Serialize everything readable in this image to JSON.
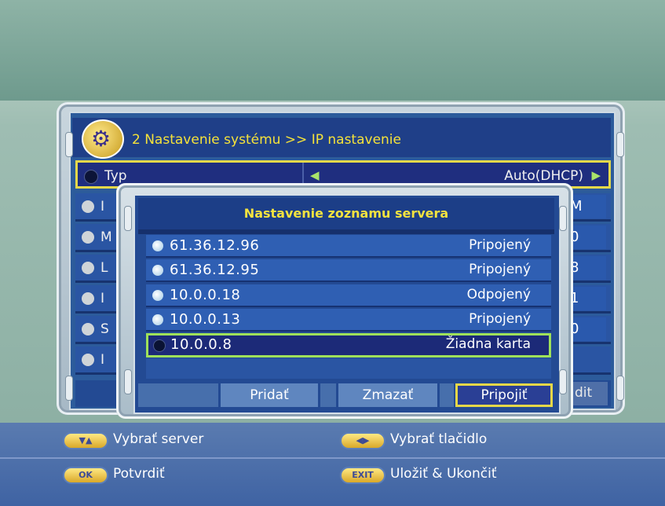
{
  "window": {
    "title": "2 Nastavenie systému >> IP nastavenie",
    "typ_label": "Typ",
    "typ_value": "Auto(DHCP)",
    "bg_row_initials": [
      "I",
      "M",
      "L",
      "I",
      "S",
      "I"
    ],
    "bg_row_values": [
      "M",
      "0",
      "8",
      "1",
      "0"
    ],
    "bg_button_label": "dit"
  },
  "dialog": {
    "title": "Nastavenie zoznamu servera",
    "servers": [
      {
        "ip": "61.36.12.96",
        "status": "Pripojený"
      },
      {
        "ip": "61.36.12.95",
        "status": "Pripojený"
      },
      {
        "ip": "10.0.0.18",
        "status": "Odpojený"
      },
      {
        "ip": "10.0.0.13",
        "status": "Pripojený"
      },
      {
        "ip": "10.0.0.8",
        "status": "Žiadna karta"
      }
    ],
    "buttons": {
      "add": "Pridať",
      "delete": "Zmazať",
      "connect": "Pripojiť"
    }
  },
  "help": {
    "select_server_key": "▼▲",
    "select_server": "Vybrať server",
    "select_button_key": "◀▶",
    "select_button": "Vybrať tlačidlo",
    "ok_key": "OK",
    "confirm": "Potvrdiť",
    "exit_key": "EXIT",
    "save_exit": "Uložiť & Ukončiť"
  },
  "colors": {
    "title_text": "#f4e33f",
    "highlight_border": "#e5d848",
    "selected_row_border": "#9fe15a"
  }
}
